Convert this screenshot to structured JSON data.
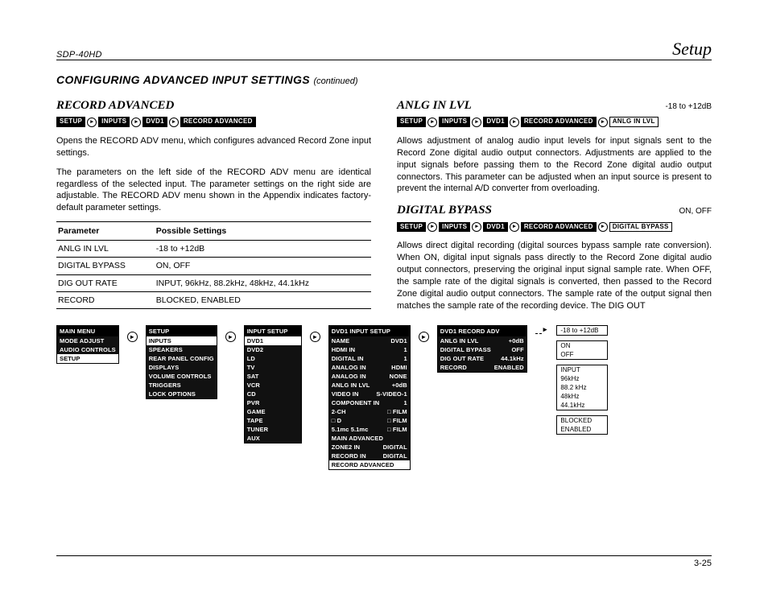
{
  "header": {
    "model": "SDP-40HD",
    "section": "Setup",
    "page": "3-25"
  },
  "title": {
    "main": "CONFIGURING ADVANCED INPUT SETTINGS",
    "cont": "(continued)"
  },
  "left": {
    "subhead": "RECORD ADVANCED",
    "crumbs": [
      "SETUP",
      "INPUTS",
      "DVD1",
      "RECORD ADVANCED"
    ],
    "p1": "Opens the RECORD ADV menu, which configures advanced Record Zone input settings.",
    "p2": "The parameters on the left side of the RECORD ADV menu are identical regardless of the selected input. The parameter settings on the right side are adjustable. The RECORD ADV menu shown in the Appendix indicates factory-default parameter settings.",
    "table": {
      "h1": "Parameter",
      "h2": "Possible Settings",
      "rows": [
        {
          "p": "ANLG IN LVL",
          "s": "-18 to +12dB"
        },
        {
          "p": "DIGITAL BYPASS",
          "s": "ON, OFF"
        },
        {
          "p": "DIG OUT RATE",
          "s": "INPUT, 96kHz, 88.2kHz, 48kHz, 44.1kHz"
        },
        {
          "p": "RECORD",
          "s": "BLOCKED, ENABLED"
        }
      ]
    }
  },
  "right": {
    "s1": {
      "subhead": "ANLG IN LVL",
      "range": "-18 to +12dB",
      "crumbs": [
        "SETUP",
        "INPUTS",
        "DVD1",
        "RECORD ADVANCED",
        "ANLG IN LVL"
      ],
      "p": "Allows adjustment of analog audio input levels for input signals sent to the Record Zone digital audio output connectors. Adjustments are applied to the input signals before passing them to the Record Zone digital audio output connectors. This parameter can be adjusted when an input source is present to prevent the internal A/D converter from overloading."
    },
    "s2": {
      "subhead": "DIGITAL BYPASS",
      "range": "ON, OFF",
      "crumbs": [
        "SETUP",
        "INPUTS",
        "DVD1",
        "RECORD ADVANCED",
        "DIGITAL BYPASS"
      ],
      "p": "Allows direct digital recording (digital sources bypass sample rate conversion). When ON, digital input signals pass directly to the Record Zone digital audio output connectors, preserving the original input signal sample rate. When OFF, the sample rate of the digital signals is converted, then passed to the Record Zone digital audio output connectors. The sample rate of the output signal then matches the sample rate of the recording device. The DIG OUT"
    }
  },
  "menus": {
    "m1": {
      "title": "MAIN MENU",
      "rows": [
        "MODE ADJUST",
        "AUDIO CONTROLS",
        "SETUP"
      ],
      "sel": 2
    },
    "m2": {
      "title": "SETUP",
      "rows": [
        "INPUTS",
        "SPEAKERS",
        "REAR PANEL CONFIG",
        "DISPLAYS",
        "VOLUME CONTROLS",
        "TRIGGERS",
        "LOCK OPTIONS"
      ],
      "sel": 0
    },
    "m3": {
      "title": "INPUT SETUP",
      "rows": [
        "DVD1",
        "DVD2",
        "LD",
        "TV",
        "SAT",
        "VCR",
        "CD",
        "PVR",
        "GAME",
        "TAPE",
        "TUNER",
        "AUX"
      ],
      "sel": 0
    },
    "m4": {
      "title": "DVD1 INPUT SETUP",
      "rows": [
        {
          "k": "NAME",
          "v": "DVD1"
        },
        {
          "k": "HDMI IN",
          "v": "1"
        },
        {
          "k": "DIGITAL IN",
          "v": "1"
        },
        {
          "k": "ANALOG IN",
          "v": "HDMI"
        },
        {
          "k": "ANALOG IN",
          "v": "NONE"
        },
        {
          "k": "ANLG IN LVL",
          "v": "+0dB"
        },
        {
          "k": "VIDEO IN",
          "v": "S-VIDEO-1"
        },
        {
          "k": "COMPONENT IN",
          "v": "1"
        },
        {
          "k": "2-CH",
          "v": "□ FILM"
        },
        {
          "k": "□ D",
          "v": "□ FILM"
        },
        {
          "k": "5.1mc    5.1mc",
          "v": "□ FILM"
        },
        {
          "k": "MAIN ADVANCED",
          "v": ""
        },
        {
          "k": "ZONE2 IN",
          "v": "DIGITAL"
        },
        {
          "k": "RECORD IN",
          "v": "DIGITAL"
        },
        {
          "k": "RECORD ADVANCED",
          "v": ""
        }
      ],
      "sel": 14
    },
    "m5": {
      "title": "DVD1 RECORD ADV",
      "rows": [
        {
          "k": "ANLG IN LVL",
          "v": "+0dB"
        },
        {
          "k": "DIGITAL BYPASS",
          "v": "OFF"
        },
        {
          "k": "DIG OUT RATE",
          "v": "44.1kHz"
        },
        {
          "k": "RECORD",
          "v": "ENABLED"
        }
      ]
    },
    "opts": {
      "b1": [
        "-18 to +12dB"
      ],
      "b2": [
        "ON",
        "OFF"
      ],
      "b3": [
        "INPUT",
        "96kHz",
        "88.2 kHz",
        "48kHz",
        "44.1kHz"
      ],
      "b4": [
        "BLOCKED",
        "ENABLED"
      ]
    }
  }
}
